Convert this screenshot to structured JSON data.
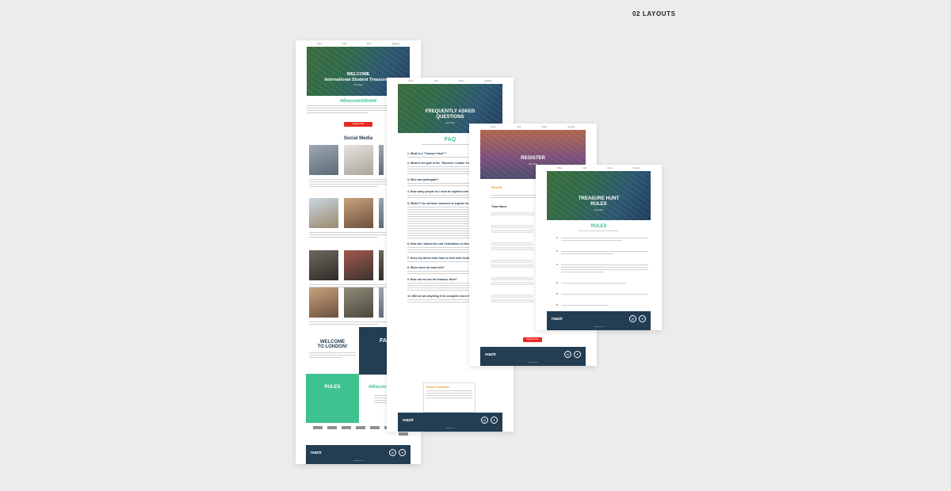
{
  "section": {
    "label": "02  LAYOUTS"
  },
  "colors": {
    "teal": "#3ec28f",
    "navy": "#233d52",
    "red": "#e8291f",
    "background": "#ececec"
  },
  "nav": {
    "items": [
      "Home",
      "FAQ",
      "Rules",
      "Register"
    ]
  },
  "footer": {
    "logo": "reactr",
    "note": "Terms of Use",
    "social": [
      "instagram-icon",
      "twitter-icon"
    ]
  },
  "page_welcome": {
    "hero_title_1": "WELCOME",
    "hero_title_2": "International Student Treasure H",
    "hero_date": "May 2019",
    "hashtag": "#discoverldnont",
    "cta": "Register Now",
    "social_heading": "Social Media",
    "welcome_block": "WELCOME TO LONDON!",
    "faq_block": "FA",
    "rules_block": "RULES",
    "hashtag2": "#discove"
  },
  "page_faq": {
    "hero_title_1": "FREQUENTLY ASKED",
    "hero_title_2": "QUESTIONS",
    "hero_date": "May 2019",
    "heading": "FAQ",
    "questions": [
      "1. What is a \"Treasure Hunt\"?",
      "2. What is the goal of the \"Discover London Tre",
      "3. Who can participate?",
      "4. How many people do I need to register a tea",
      "5. What if I do not have someone to register wi",
      "6. How can I attend the end Celebration on Nov",
      "7. Does my whole team have to visit each locati",
      "8. When does the hunt end?",
      "9. How can we win the treasure Hunt?",
      "10. Will we win anything if we complete more th"
    ],
    "remember_heading": "Please remember:"
  },
  "page_register": {
    "hero_title": "REGISTER",
    "hero_date": "May 2019",
    "rules_label": "RULES",
    "team_label": "Team Name",
    "submit": "Register Now"
  },
  "page_rules": {
    "hero_title_1": "TREASURE HUNT",
    "hero_title_2": "RULES",
    "hero_date": "May 2019",
    "heading": "RULES",
    "items": [
      "1.",
      "2.",
      "3.",
      "4.",
      "5.",
      "6."
    ]
  }
}
